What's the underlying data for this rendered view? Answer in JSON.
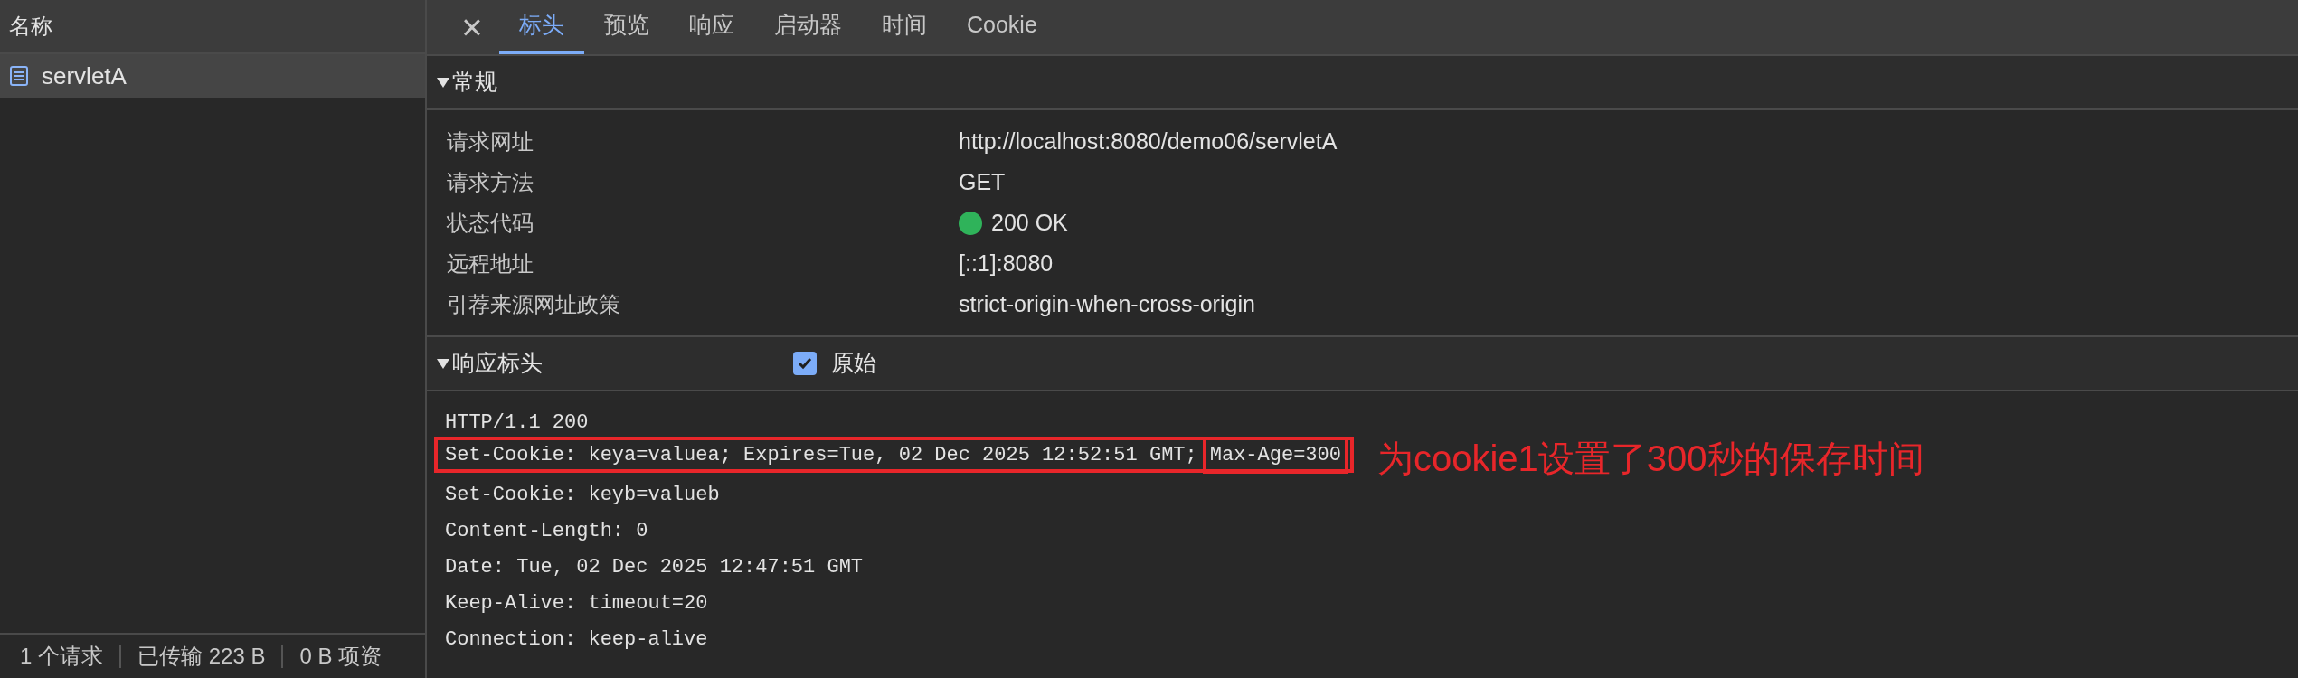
{
  "requests": {
    "column": "名称",
    "items": [
      {
        "name": "servletA",
        "selected": true
      }
    ]
  },
  "status_bar": [
    "1 个请求",
    "已传输 223 B",
    "0 B 项资"
  ],
  "tabs": [
    {
      "label": "标头",
      "selected": true
    },
    {
      "label": "预览",
      "selected": false
    },
    {
      "label": "响应",
      "selected": false
    },
    {
      "label": "启动器",
      "selected": false
    },
    {
      "label": "时间",
      "selected": false
    },
    {
      "label": "Cookie",
      "selected": false
    }
  ],
  "close": "×",
  "general": {
    "title": "常规",
    "expanded": true,
    "rows": [
      {
        "label": "请求网址",
        "value": "http://localhost:8080/demo06/servletA"
      },
      {
        "label": "请求方法",
        "value": "GET"
      },
      {
        "label": "状态代码",
        "value": "200 OK",
        "color": "#2fb35a"
      },
      {
        "label": "远程地址",
        "value": "[::1]:8080"
      },
      {
        "label": "引荐来源网址政策",
        "value": "strict-origin-when-cross-origin"
      }
    ]
  },
  "response_headers": {
    "title": "响应标头",
    "expanded": true,
    "raw": {
      "label": "原始",
      "checked": true
    },
    "lines": [
      {
        "boxed": false,
        "segments": [
          {
            "text": "HTTP/1.1 200",
            "boxed": false
          }
        ]
      },
      {
        "boxed": true,
        "segments": [
          {
            "text": "Set-Cookie: keya=valuea; Expires=Tue, 02 Dec 2025 12:52:51 GMT;",
            "boxed": false
          },
          {
            "text": "Max-Age=300",
            "boxed": true
          }
        ]
      },
      {
        "boxed": false,
        "segments": [
          {
            "text": "Set-Cookie: keyb=valueb",
            "boxed": false
          }
        ]
      },
      {
        "boxed": false,
        "segments": [
          {
            "text": "Content-Length: 0",
            "boxed": false
          }
        ]
      },
      {
        "boxed": false,
        "segments": [
          {
            "text": "Date: Tue, 02 Dec 2025 12:47:51 GMT",
            "boxed": false
          }
        ]
      },
      {
        "boxed": false,
        "segments": [
          {
            "text": "Keep-Alive: timeout=20",
            "boxed": false
          }
        ]
      },
      {
        "boxed": false,
        "segments": [
          {
            "text": "Connection: keep-alive",
            "boxed": false
          }
        ]
      }
    ]
  },
  "annotation": "为cookie1设置了300秒的保存时间"
}
